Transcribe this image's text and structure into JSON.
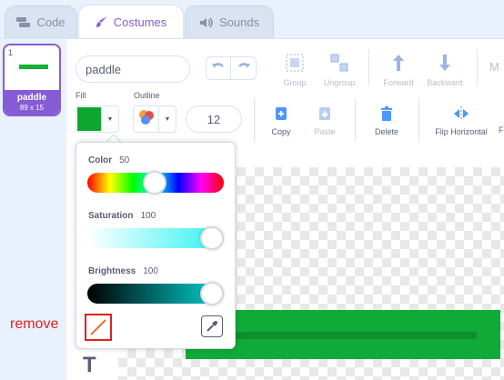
{
  "tabs": [
    {
      "label": "Code",
      "icon": "code-blocks-icon"
    },
    {
      "label": "Costumes",
      "icon": "paintbrush-icon"
    },
    {
      "label": "Sounds",
      "icon": "speaker-icon"
    }
  ],
  "costume": {
    "number": "1",
    "name": "paddle",
    "size": "89 x 15"
  },
  "name_field": {
    "value": "paddle"
  },
  "toolbar": {
    "group": "Group",
    "ungroup": "Ungroup",
    "forward": "Forward",
    "backward": "Backward",
    "more": "M"
  },
  "fill": {
    "label": "Fill",
    "color": "#0fa531"
  },
  "outline": {
    "label": "Outline",
    "width": "12"
  },
  "actions": {
    "copy": "Copy",
    "paste": "Paste",
    "delete": "Delete",
    "flip_h": "Flip Horizontal",
    "flip_v_partial": "F"
  },
  "color_picker": {
    "color_label": "Color",
    "color_value": "50",
    "saturation_label": "Saturation",
    "saturation_value": "100",
    "brightness_label": "Brightness",
    "brightness_value": "100"
  },
  "annotation": {
    "remove_label": "remove"
  },
  "colors": {
    "accent": "#855cd6",
    "paddle": "#0faa37",
    "annotation": "#e02020"
  }
}
